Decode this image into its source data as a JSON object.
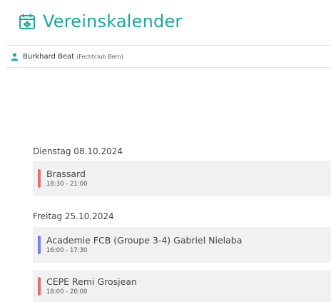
{
  "header": {
    "title": "Vereinskalender",
    "icon": "calendar-clover-icon",
    "accent": "#1aa89a"
  },
  "user": {
    "name": "Burkhard Beat",
    "club": "(Fechtclub Bern)",
    "icon": "person-icon"
  },
  "days": [
    {
      "label": "Dienstag 08.10.2024",
      "events": [
        {
          "title": "Brassard",
          "time": "18:30 - 21:00",
          "color": "#e07070"
        }
      ]
    },
    {
      "label": "Freitag 25.10.2024",
      "events": [
        {
          "title": "Academie FCB (Groupe 3-4) Gabriel Nielaba",
          "time": "16:00 - 17:30",
          "color": "#7a7fe0"
        },
        {
          "title": "CEPE Remi Grosjean",
          "time": "18:00 - 20:00",
          "color": "#e07070"
        }
      ]
    }
  ]
}
